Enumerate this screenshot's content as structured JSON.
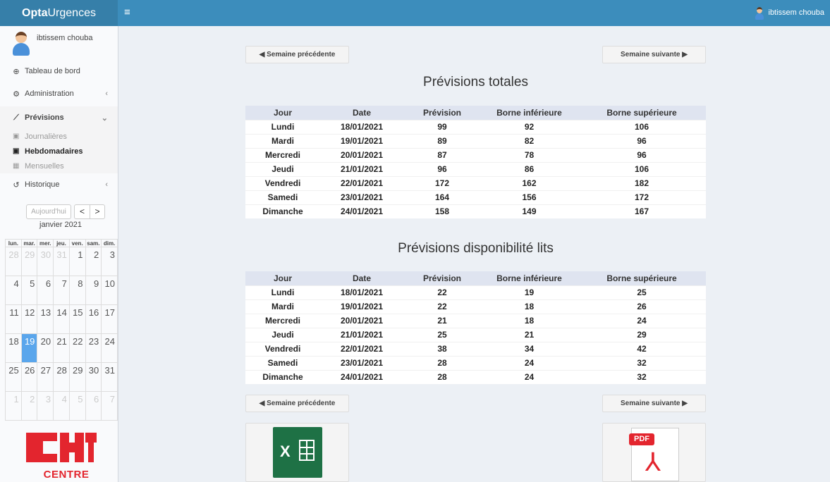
{
  "app": {
    "logo_bold": "Opta",
    "logo_rest": "Urgences",
    "menu_toggle": "≡",
    "user_name": "ibtissem chouba"
  },
  "sidebar": {
    "user_name": "ibtissem chouba",
    "items": [
      {
        "label": "Tableau de bord",
        "icon": "dashboard-icon"
      },
      {
        "label": "Administration",
        "icon": "cogs-icon"
      },
      {
        "label": "Prévisions",
        "icon": "line-chart-icon"
      },
      {
        "label": "Historique",
        "icon": "history-icon"
      }
    ],
    "sub_items": [
      {
        "label": "Journalières",
        "icon": "calendar-day-icon"
      },
      {
        "label": "Hebdomadaires",
        "icon": "calendar-week-icon"
      },
      {
        "label": "Mensuelles",
        "icon": "calendar-month-icon"
      }
    ]
  },
  "calendar": {
    "today_label": "Aujourd'hui",
    "prev": "<",
    "next": ">",
    "month": "janvier 2021",
    "weekdays": [
      "lun.",
      "mar.",
      "mer.",
      "jeu.",
      "ven.",
      "sam.",
      "dim."
    ],
    "weeks": [
      [
        "28",
        "29",
        "30",
        "31",
        "1",
        "2",
        "3"
      ],
      [
        "4",
        "5",
        "6",
        "7",
        "8",
        "9",
        "10"
      ],
      [
        "11",
        "12",
        "13",
        "14",
        "15",
        "16",
        "17"
      ],
      [
        "18",
        "19",
        "20",
        "21",
        "22",
        "23",
        "24"
      ],
      [
        "25",
        "26",
        "27",
        "28",
        "29",
        "30",
        "31"
      ],
      [
        "1",
        "2",
        "3",
        "4",
        "5",
        "6",
        "7"
      ]
    ],
    "selected_day": "19"
  },
  "org": {
    "name": "CENTRE",
    "brand_color": "#e3252e"
  },
  "nav": {
    "prev_label": "◀ Semaine précédente",
    "next_label": "Semaine suivante ▶"
  },
  "tables": [
    {
      "title": "Prévisions totales",
      "headers": [
        "Jour",
        "Date",
        "Prévision",
        "Borne inférieure",
        "Borne supérieure"
      ],
      "rows": [
        [
          "Lundi",
          "18/01/2021",
          "99",
          "92",
          "106"
        ],
        [
          "Mardi",
          "19/01/2021",
          "89",
          "82",
          "96"
        ],
        [
          "Mercredi",
          "20/01/2021",
          "87",
          "78",
          "96"
        ],
        [
          "Jeudi",
          "21/01/2021",
          "96",
          "86",
          "106"
        ],
        [
          "Vendredi",
          "22/01/2021",
          "172",
          "162",
          "182"
        ],
        [
          "Samedi",
          "23/01/2021",
          "164",
          "156",
          "172"
        ],
        [
          "Dimanche",
          "24/01/2021",
          "158",
          "149",
          "167"
        ]
      ]
    },
    {
      "title": "Prévisions disponibilité lits",
      "headers": [
        "Jour",
        "Date",
        "Prévision",
        "Borne inférieure",
        "Borne supérieure"
      ],
      "rows": [
        [
          "Lundi",
          "18/01/2021",
          "22",
          "19",
          "25"
        ],
        [
          "Mardi",
          "19/01/2021",
          "22",
          "18",
          "26"
        ],
        [
          "Mercredi",
          "20/01/2021",
          "21",
          "18",
          "24"
        ],
        [
          "Jeudi",
          "21/01/2021",
          "25",
          "21",
          "29"
        ],
        [
          "Vendredi",
          "22/01/2021",
          "38",
          "34",
          "42"
        ],
        [
          "Samedi",
          "23/01/2021",
          "28",
          "24",
          "32"
        ],
        [
          "Dimanche",
          "24/01/2021",
          "28",
          "24",
          "32"
        ]
      ]
    }
  ],
  "exports": {
    "excel_icon": "excel-icon",
    "pdf_icon": "pdf-icon",
    "excel_letter": "X",
    "pdf_tag": "PDF"
  }
}
